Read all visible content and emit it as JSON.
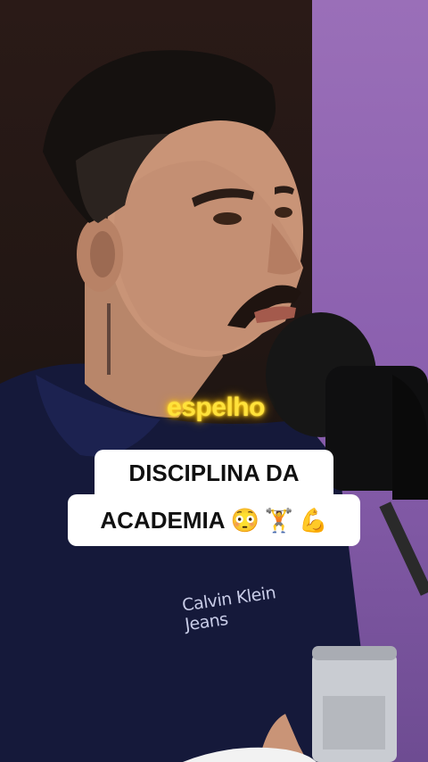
{
  "video": {
    "caption_word": "espelho",
    "title_line1": "DISCIPLINA DA",
    "title_line2": "ACADEMIA",
    "title_emojis": [
      "😳",
      "🏋️",
      "💪"
    ],
    "shirt_brand": "Calvin Klein Jeans"
  },
  "colors": {
    "background_right": "#8a5fae",
    "caption_yellow": "#ffe23a",
    "title_bg": "#ffffff"
  }
}
